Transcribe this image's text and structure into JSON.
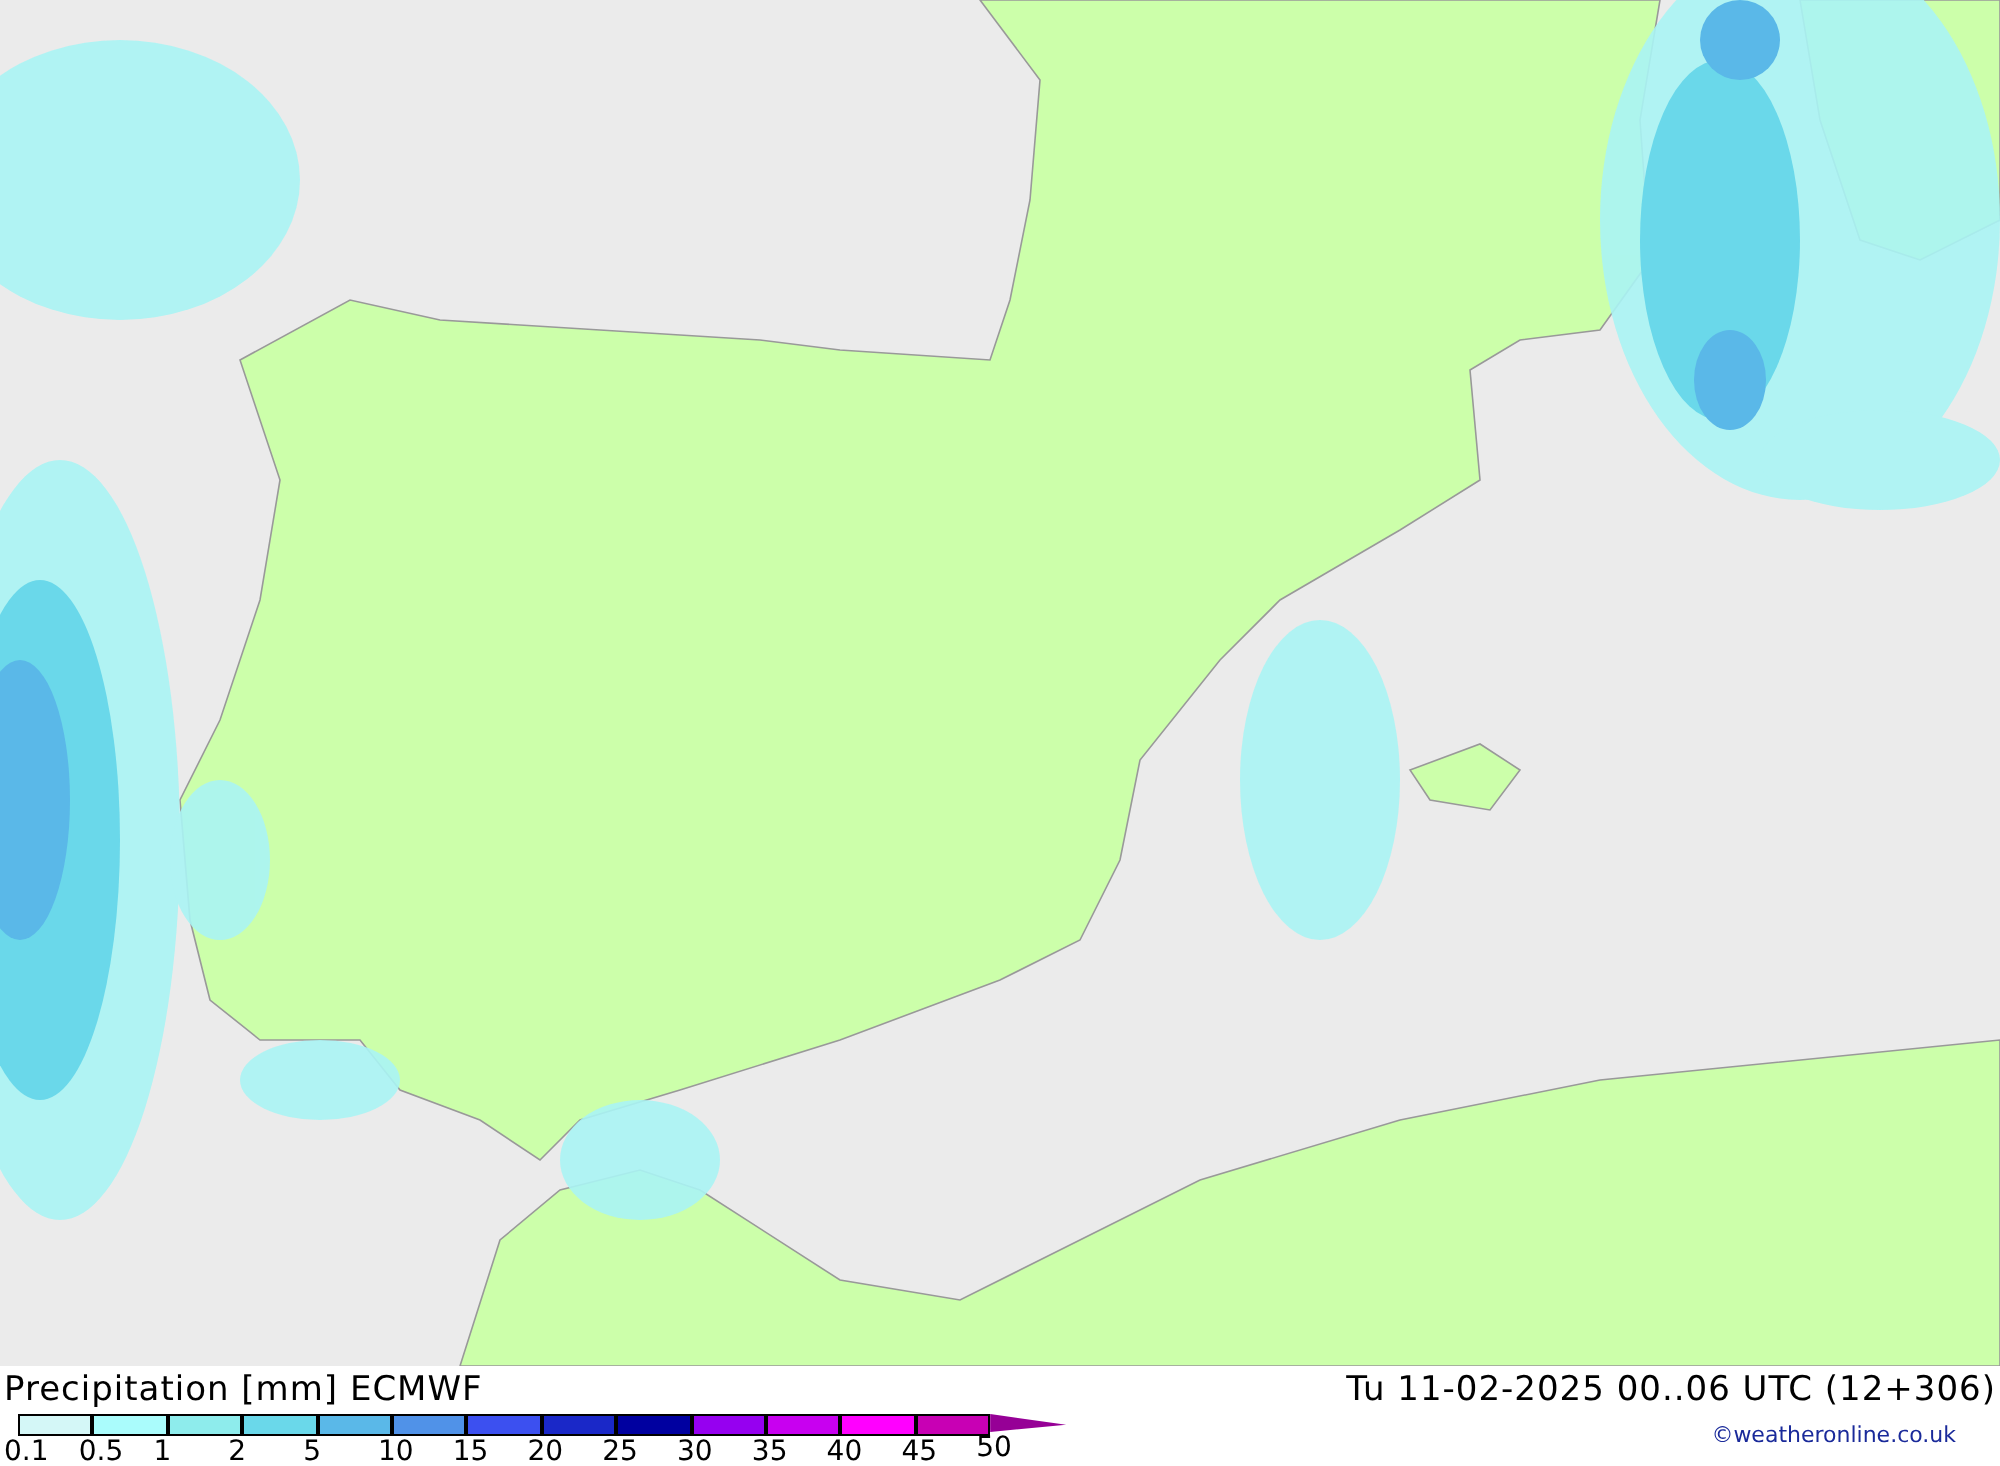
{
  "map": {
    "title": "Precipitation [mm] ECMWF",
    "valid_time": "Tu 11-02-2025 00..06 UTC (12+306)"
  },
  "legend": [
    {
      "label": "0.1",
      "color": "#d4f7f7"
    },
    {
      "label": "0.5",
      "color": "#aafcfc"
    },
    {
      "label": "1",
      "color": "#8eecec"
    },
    {
      "label": "2",
      "color": "#6ad8ea"
    },
    {
      "label": "5",
      "color": "#5ab8e8"
    },
    {
      "label": "10",
      "color": "#5092e8"
    },
    {
      "label": "15",
      "color": "#3c50f0"
    },
    {
      "label": "20",
      "color": "#1a28c8"
    },
    {
      "label": "25",
      "color": "#0000a0"
    },
    {
      "label": "30",
      "color": "#9600f0"
    },
    {
      "label": "35",
      "color": "#c800f0"
    },
    {
      "label": "40",
      "color": "#ff00ff"
    },
    {
      "label": "45",
      "color": "#c800b4"
    },
    {
      "label": "50",
      "color": "#960096"
    }
  ],
  "copyright": "©weatheronline.co.uk"
}
